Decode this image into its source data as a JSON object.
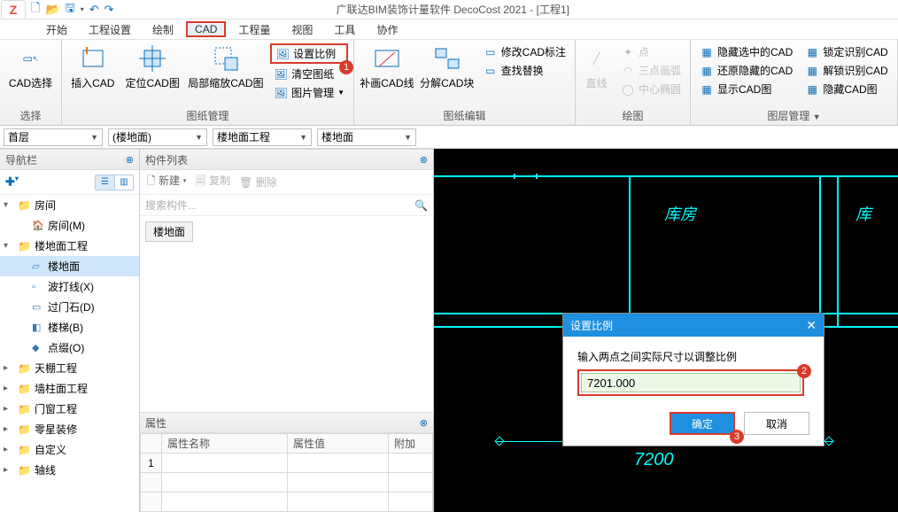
{
  "app": {
    "title": "广联达BIM装饰计量软件 DecoCost 2021 - [工程1]"
  },
  "menu": {
    "items": [
      "开始",
      "工程设置",
      "绘制",
      "CAD",
      "工程量",
      "视图",
      "工具",
      "协作"
    ],
    "active": 3
  },
  "ribbon": {
    "group1": {
      "label": "选择",
      "btn1": "CAD选择"
    },
    "group2": {
      "label": "图纸管理",
      "btn_insert": "插入CAD",
      "btn_locate": "定位CAD图",
      "btn_local": "局部缩放CAD图",
      "set_scale": "设置比例",
      "clear": "清空图纸",
      "img_mgr": "图片管理"
    },
    "group3": {
      "label": "图纸编辑",
      "fill": "补画CAD线",
      "split": "分解CAD块",
      "modify": "修改CAD标注",
      "find": "查找替换"
    },
    "group4": {
      "label": "绘图",
      "line": "直线",
      "pt": "点",
      "arc": "三点画弧",
      "ellipse": "中心椭圆"
    },
    "group5": {
      "label": "图层管理",
      "hide_sel": "隐藏选中的CAD",
      "restore": "还原隐藏的CAD",
      "show": "显示CAD图",
      "lock": "锁定识别CAD",
      "unlock": "解锁识别CAD",
      "hide_cad": "隐藏CAD图"
    }
  },
  "selectors": {
    "s1": "首层",
    "s2": "(楼地面)",
    "s3": "楼地面工程",
    "s4": "楼地面"
  },
  "nav": {
    "title": "导航栏",
    "nodes": [
      {
        "t": "房间",
        "l": 1,
        "open": true
      },
      {
        "t": "房间(M)",
        "l": 2,
        "ico": "🏠"
      },
      {
        "t": "楼地面工程",
        "l": 1,
        "open": true
      },
      {
        "t": "楼地面",
        "l": 2,
        "ico": "▱",
        "sel": true
      },
      {
        "t": "波打线(X)",
        "l": 2,
        "ico": "▫"
      },
      {
        "t": "过门石(D)",
        "l": 2,
        "ico": "▭"
      },
      {
        "t": "楼梯(B)",
        "l": 2,
        "ico": "◧"
      },
      {
        "t": "点缀(O)",
        "l": 2,
        "ico": "◆"
      },
      {
        "t": "天棚工程",
        "l": 1
      },
      {
        "t": "墙柱面工程",
        "l": 1
      },
      {
        "t": "门窗工程",
        "l": 1
      },
      {
        "t": "零星装修",
        "l": 1
      },
      {
        "t": "自定义",
        "l": 1
      },
      {
        "t": "轴线",
        "l": 1
      }
    ]
  },
  "complist": {
    "title": "构件列表",
    "new": "新建",
    "copy": "复制",
    "del": "删除",
    "search_ph": "搜索构件...",
    "chip": "楼地面"
  },
  "props": {
    "title": "属性",
    "col_name": "属性名称",
    "col_val": "属性值",
    "col_extra": "附加",
    "row1": "1"
  },
  "canvas": {
    "room1": "库房",
    "room2": "库",
    "dim": "7200"
  },
  "dialog": {
    "title": "设置比例",
    "hint": "输入两点之间实际尺寸以调整比例",
    "value": "7201.000",
    "ok": "确定",
    "cancel": "取消"
  },
  "badges": {
    "b1": "1",
    "b2": "2",
    "b3": "3"
  }
}
